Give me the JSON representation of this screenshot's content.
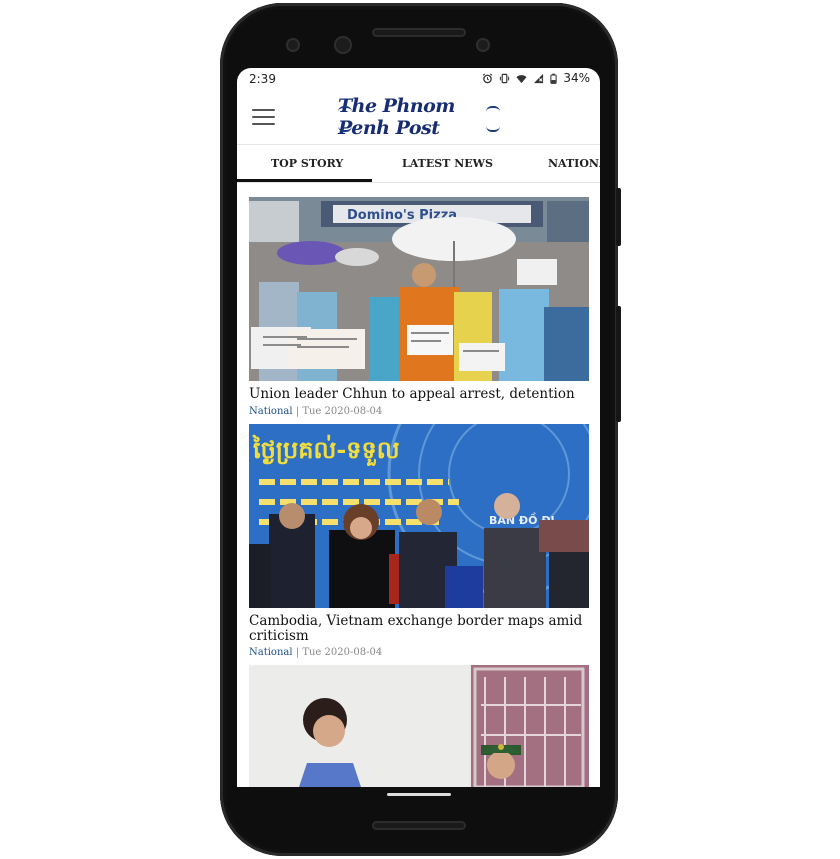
{
  "status_bar": {
    "time": "2:39",
    "battery": "34%",
    "icons": [
      "alarm-icon",
      "vibrate-icon",
      "wifi-icon",
      "signal-icon",
      "battery-icon"
    ]
  },
  "app_bar": {
    "logo_text": "The Phnom Penh Post",
    "menu_icon": "hamburger-menu-icon"
  },
  "tabs": [
    {
      "label": "TOP STORY",
      "selected": true
    },
    {
      "label": "LATEST NEWS",
      "selected": false
    },
    {
      "label": "NATIONAL",
      "selected": false
    }
  ],
  "articles": [
    {
      "headline": "Union leader Chhun to appeal arrest, detention",
      "category": "National",
      "separator": "|",
      "date": "Tue 2020-08-04",
      "image_signage": "Domino's Pizza"
    },
    {
      "headline": "Cambodia, Vietnam exchange border maps amid criticism",
      "category": "National",
      "separator": "|",
      "date": "Tue 2020-08-04",
      "image_signage": "BẢN ĐỒ ĐỊ"
    },
    {
      "headline": "",
      "category": "",
      "date": ""
    }
  ],
  "colors": {
    "logo_blue": "#172c72",
    "category_blue": "#1d4f8c",
    "tab_indicator": "#111111"
  }
}
